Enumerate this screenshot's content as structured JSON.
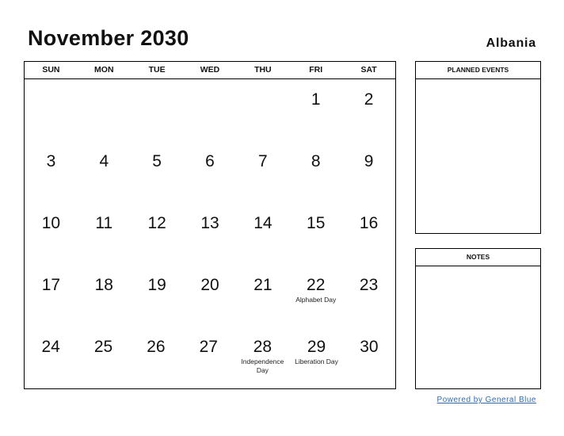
{
  "header": {
    "title": "November 2030",
    "country": "Albania"
  },
  "calendar": {
    "weekdays": [
      "SUN",
      "MON",
      "TUE",
      "WED",
      "THU",
      "FRI",
      "SAT"
    ],
    "weeks": [
      [
        {
          "d": ""
        },
        {
          "d": ""
        },
        {
          "d": ""
        },
        {
          "d": ""
        },
        {
          "d": ""
        },
        {
          "d": "1"
        },
        {
          "d": "2"
        }
      ],
      [
        {
          "d": "3"
        },
        {
          "d": "4"
        },
        {
          "d": "5"
        },
        {
          "d": "6"
        },
        {
          "d": "7"
        },
        {
          "d": "8"
        },
        {
          "d": "9"
        }
      ],
      [
        {
          "d": "10"
        },
        {
          "d": "11"
        },
        {
          "d": "12"
        },
        {
          "d": "13"
        },
        {
          "d": "14"
        },
        {
          "d": "15"
        },
        {
          "d": "16"
        }
      ],
      [
        {
          "d": "17"
        },
        {
          "d": "18"
        },
        {
          "d": "19"
        },
        {
          "d": "20"
        },
        {
          "d": "21"
        },
        {
          "d": "22",
          "h": "Alphabet Day"
        },
        {
          "d": "23"
        }
      ],
      [
        {
          "d": "24"
        },
        {
          "d": "25"
        },
        {
          "d": "26"
        },
        {
          "d": "27"
        },
        {
          "d": "28",
          "h": "Independence Day"
        },
        {
          "d": "29",
          "h": "Liberation Day"
        },
        {
          "d": "30"
        }
      ]
    ]
  },
  "panels": {
    "planned_events": "PLANNED EVENTS",
    "notes": "NOTES"
  },
  "footer": {
    "link": "Powered by General Blue"
  }
}
